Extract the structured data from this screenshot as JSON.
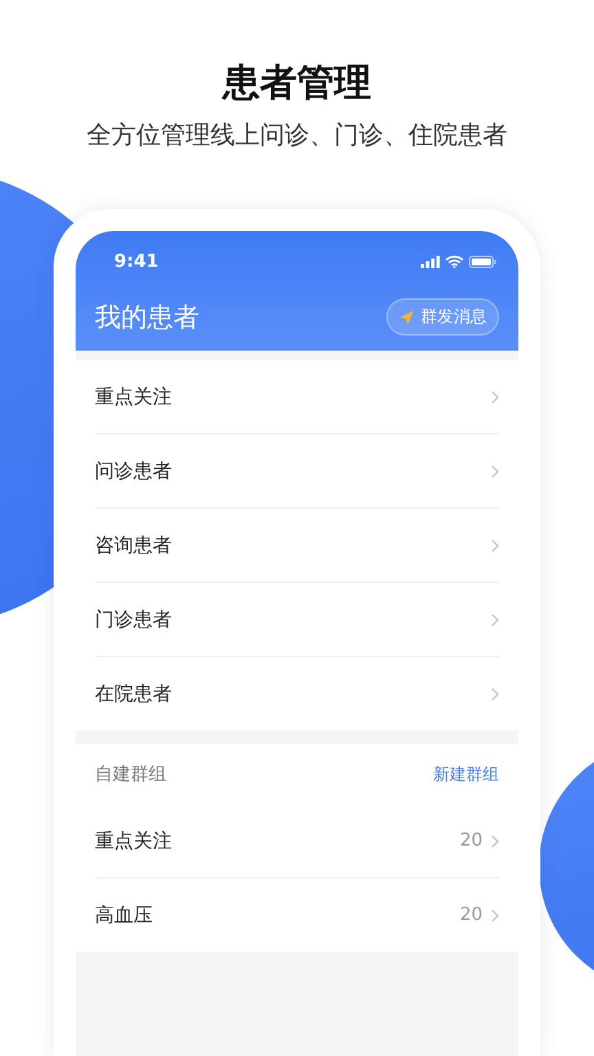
{
  "header": {
    "title": "患者管理",
    "subtitle": "全方位管理线上问诊、门诊、住院患者"
  },
  "status_bar": {
    "time": "9:41"
  },
  "nav": {
    "title": "我的患者",
    "action": "群发消息"
  },
  "categories": [
    {
      "label": "重点关注"
    },
    {
      "label": "问诊患者"
    },
    {
      "label": "咨询患者"
    },
    {
      "label": "门诊患者"
    },
    {
      "label": "在院患者"
    }
  ],
  "groups": {
    "title": "自建群组",
    "action": "新建群组",
    "items": [
      {
        "label": "重点关注",
        "count": "20"
      },
      {
        "label": "高血压",
        "count": "20"
      }
    ]
  }
}
